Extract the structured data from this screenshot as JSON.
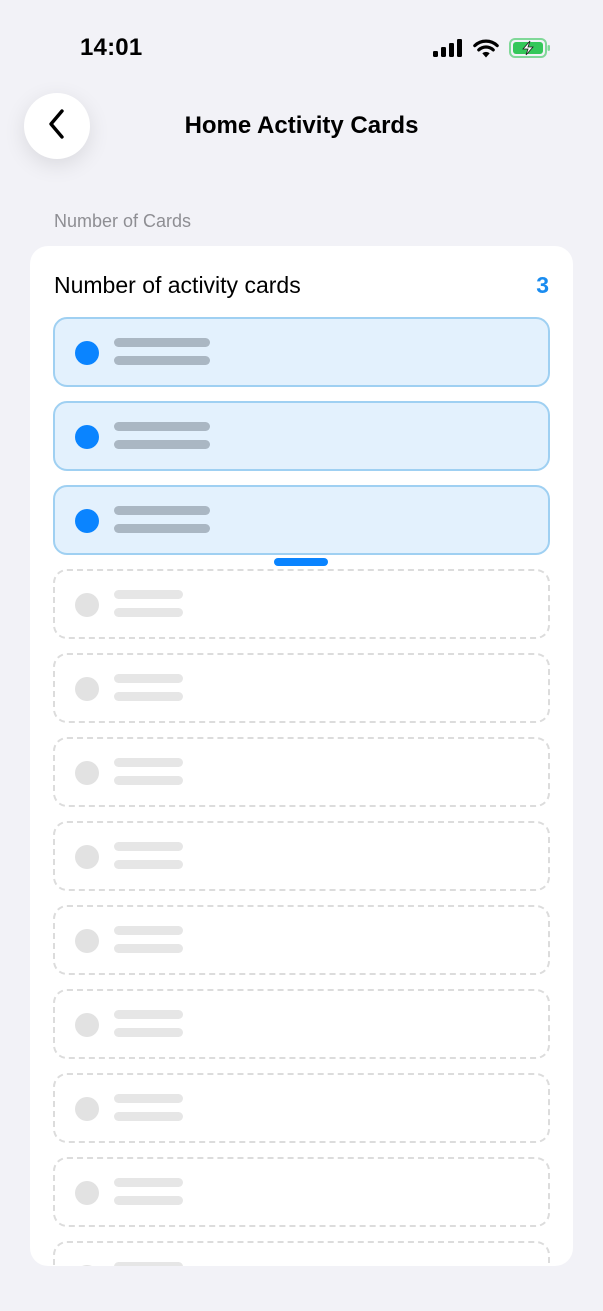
{
  "status_bar": {
    "time": "14:01"
  },
  "nav": {
    "title": "Home Activity Cards",
    "back_icon": "chevron-left-icon"
  },
  "section": {
    "label": "Number of Cards"
  },
  "card_count_row": {
    "label": "Number of activity cards",
    "value": "3"
  },
  "slots": {
    "total": 12,
    "active_count": 3
  },
  "colors": {
    "accent": "#0a84ff",
    "value_text": "#1a8cf0",
    "active_fill": "#e3f1fd",
    "active_border": "#9fd0f2",
    "background": "#f2f2f7"
  }
}
